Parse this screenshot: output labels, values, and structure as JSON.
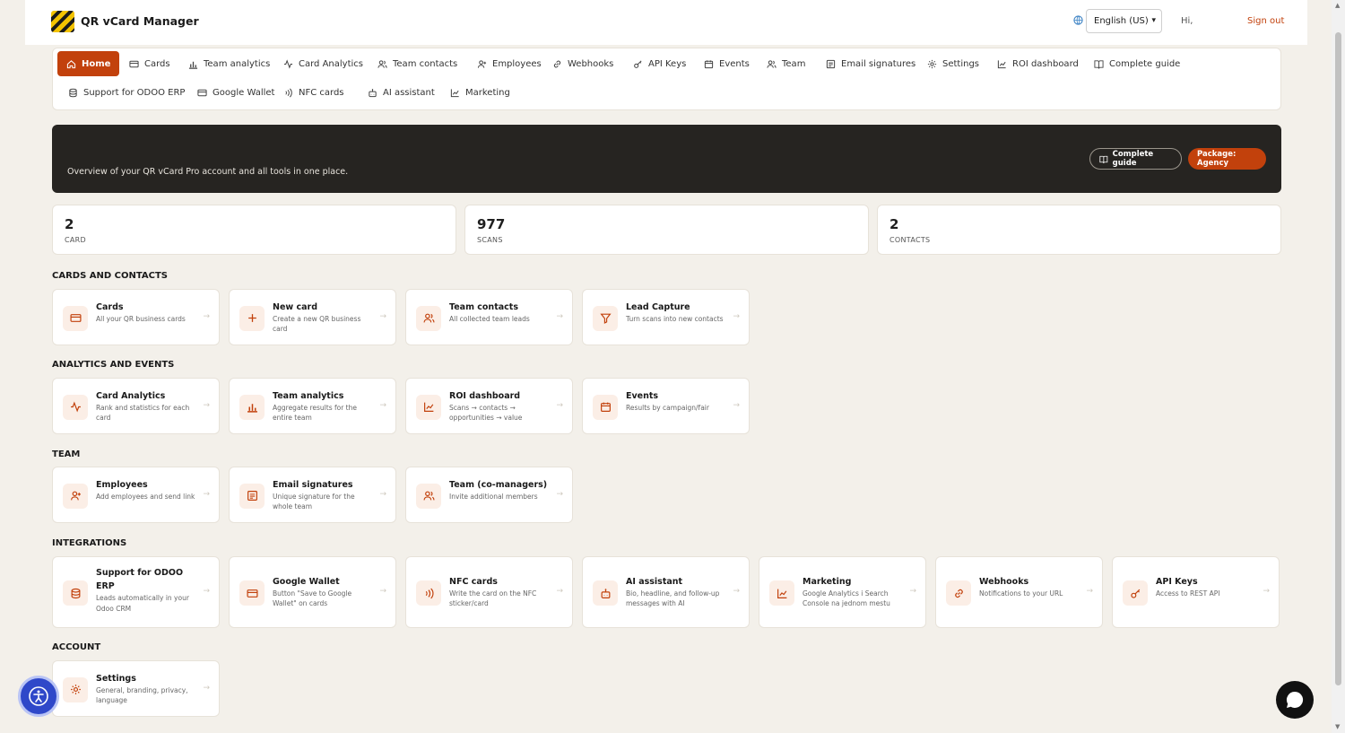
{
  "header": {
    "brand": "QR vCard Manager",
    "language": "English (US)",
    "greeting": "Hi,",
    "signout": "Sign out"
  },
  "nav": [
    {
      "label": "Home",
      "icon": "home-icon",
      "active": true
    },
    {
      "label": "Cards",
      "icon": "card-icon"
    },
    {
      "label": "Team analytics",
      "icon": "bar-chart-icon"
    },
    {
      "label": "Card Analytics",
      "icon": "activity-icon"
    },
    {
      "label": "Team contacts",
      "icon": "users-icon"
    },
    {
      "label": "Employees",
      "icon": "user-plus-icon"
    },
    {
      "label": "Webhooks",
      "icon": "link-icon"
    },
    {
      "label": "API Keys",
      "icon": "key-icon"
    },
    {
      "label": "Events",
      "icon": "calendar-icon"
    },
    {
      "label": "Team",
      "icon": "users-icon"
    },
    {
      "label": "Email signatures",
      "icon": "signature-icon"
    },
    {
      "label": "Settings",
      "icon": "gear-icon"
    },
    {
      "label": "ROI dashboard",
      "icon": "line-chart-icon"
    },
    {
      "label": "Complete guide",
      "icon": "book-icon"
    },
    {
      "label": "Support for ODOO ERP",
      "icon": "database-icon"
    },
    {
      "label": "Google Wallet",
      "icon": "wallet-icon"
    },
    {
      "label": "NFC cards",
      "icon": "nfc-icon"
    },
    {
      "label": "AI assistant",
      "icon": "bot-icon"
    },
    {
      "label": "Marketing",
      "icon": "line-chart-icon"
    }
  ],
  "hero": {
    "subtitle": "Overview of your QR vCard Pro account and all tools in one place.",
    "guide_label": "Complete guide",
    "package_label": "Package: Agency"
  },
  "stats": [
    {
      "value": "2",
      "label": "CARD"
    },
    {
      "value": "977",
      "label": "SCANS"
    },
    {
      "value": "2",
      "label": "CONTACTS"
    }
  ],
  "sections": [
    {
      "title": "CARDS AND CONTACTS",
      "cards": [
        {
          "title": "Cards",
          "desc": "All your QR business cards",
          "icon": "card-icon"
        },
        {
          "title": "New card",
          "desc": "Create a new QR business card",
          "icon": "plus-icon"
        },
        {
          "title": "Team contacts",
          "desc": "All collected team leads",
          "icon": "users-icon"
        },
        {
          "title": "Lead Capture",
          "desc": "Turn scans into new contacts",
          "icon": "filter-icon"
        }
      ]
    },
    {
      "title": "ANALYTICS AND EVENTS",
      "cards": [
        {
          "title": "Card Analytics",
          "desc": "Rank and statistics for each card",
          "icon": "activity-icon"
        },
        {
          "title": "Team analytics",
          "desc": "Aggregate results for the entire team",
          "icon": "bar-chart-icon"
        },
        {
          "title": "ROI dashboard",
          "desc": "Scans → contacts → opportunities → value",
          "icon": "line-chart-icon"
        },
        {
          "title": "Events",
          "desc": "Results by campaign/fair",
          "icon": "calendar-icon"
        }
      ]
    },
    {
      "title": "TEAM",
      "cards": [
        {
          "title": "Employees",
          "desc": "Add employees and send link",
          "icon": "user-plus-icon"
        },
        {
          "title": "Email signatures",
          "desc": "Unique signature for the whole team",
          "icon": "signature-icon"
        },
        {
          "title": "Team (co-managers)",
          "desc": "Invite additional members",
          "icon": "users-icon"
        }
      ]
    },
    {
      "title": "INTEGRATIONS",
      "cards": [
        {
          "title": "Support for ODOO ERP",
          "desc": "Leads automatically in your Odoo CRM",
          "icon": "database-icon"
        },
        {
          "title": "Google Wallet",
          "desc": "Button \"Save to Google Wallet\" on cards",
          "icon": "wallet-icon"
        },
        {
          "title": "NFC cards",
          "desc": "Write the card on the NFC sticker/card",
          "icon": "nfc-icon"
        },
        {
          "title": "AI assistant",
          "desc": "Bio, headline, and follow-up messages with AI",
          "icon": "bot-icon"
        },
        {
          "title": "Marketing",
          "desc": "Google Analytics i Search Console na jednom mestu",
          "icon": "line-chart-icon"
        },
        {
          "title": "Webhooks",
          "desc": "Notifications to your URL",
          "icon": "link-icon"
        },
        {
          "title": "API Keys",
          "desc": "Access to REST API",
          "icon": "key-icon"
        }
      ]
    },
    {
      "title": "ACCOUNT",
      "cards": [
        {
          "title": "Settings",
          "desc": "General, branding, privacy, language",
          "icon": "gear-icon"
        }
      ]
    }
  ],
  "colors": {
    "accent": "#c2410c",
    "hero_bg": "#262421",
    "page_bg": "#f3f0ea"
  }
}
